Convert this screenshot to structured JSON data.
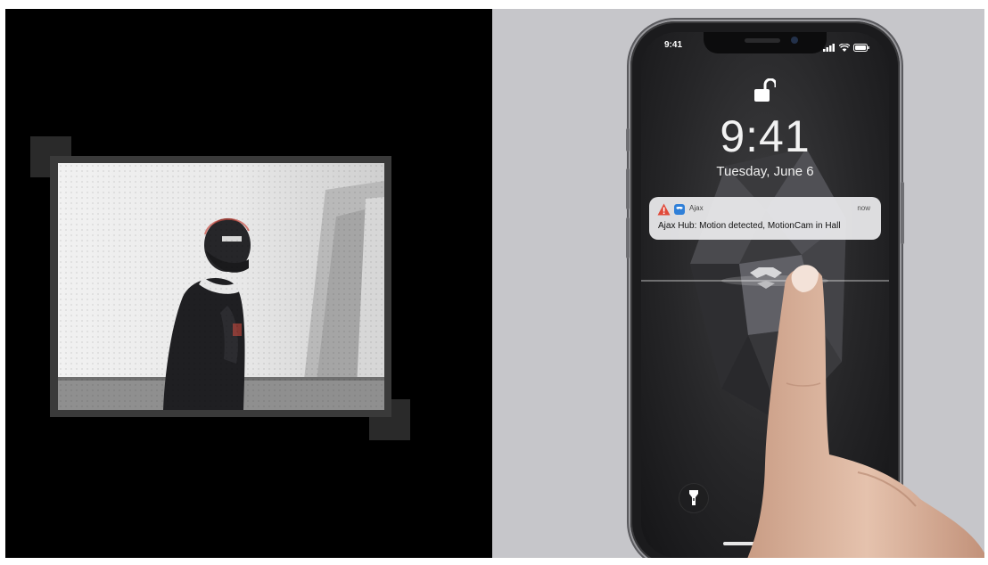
{
  "left_panel": {
    "camera_view": {}
  },
  "phone": {
    "status_bar": {
      "time": "9:41"
    },
    "lock_screen": {
      "time": "9:41",
      "date": "Tuesday, June 6"
    },
    "notification": {
      "app_name": "Ajax",
      "time": "now",
      "message": "Ajax Hub: Motion detected, MotionCam in Hall"
    }
  },
  "colors": {
    "left_background": "#000000",
    "right_background": "#c6c6ca",
    "app_icon": "#2f7fd8",
    "warning_icon": "#e04a3a"
  }
}
